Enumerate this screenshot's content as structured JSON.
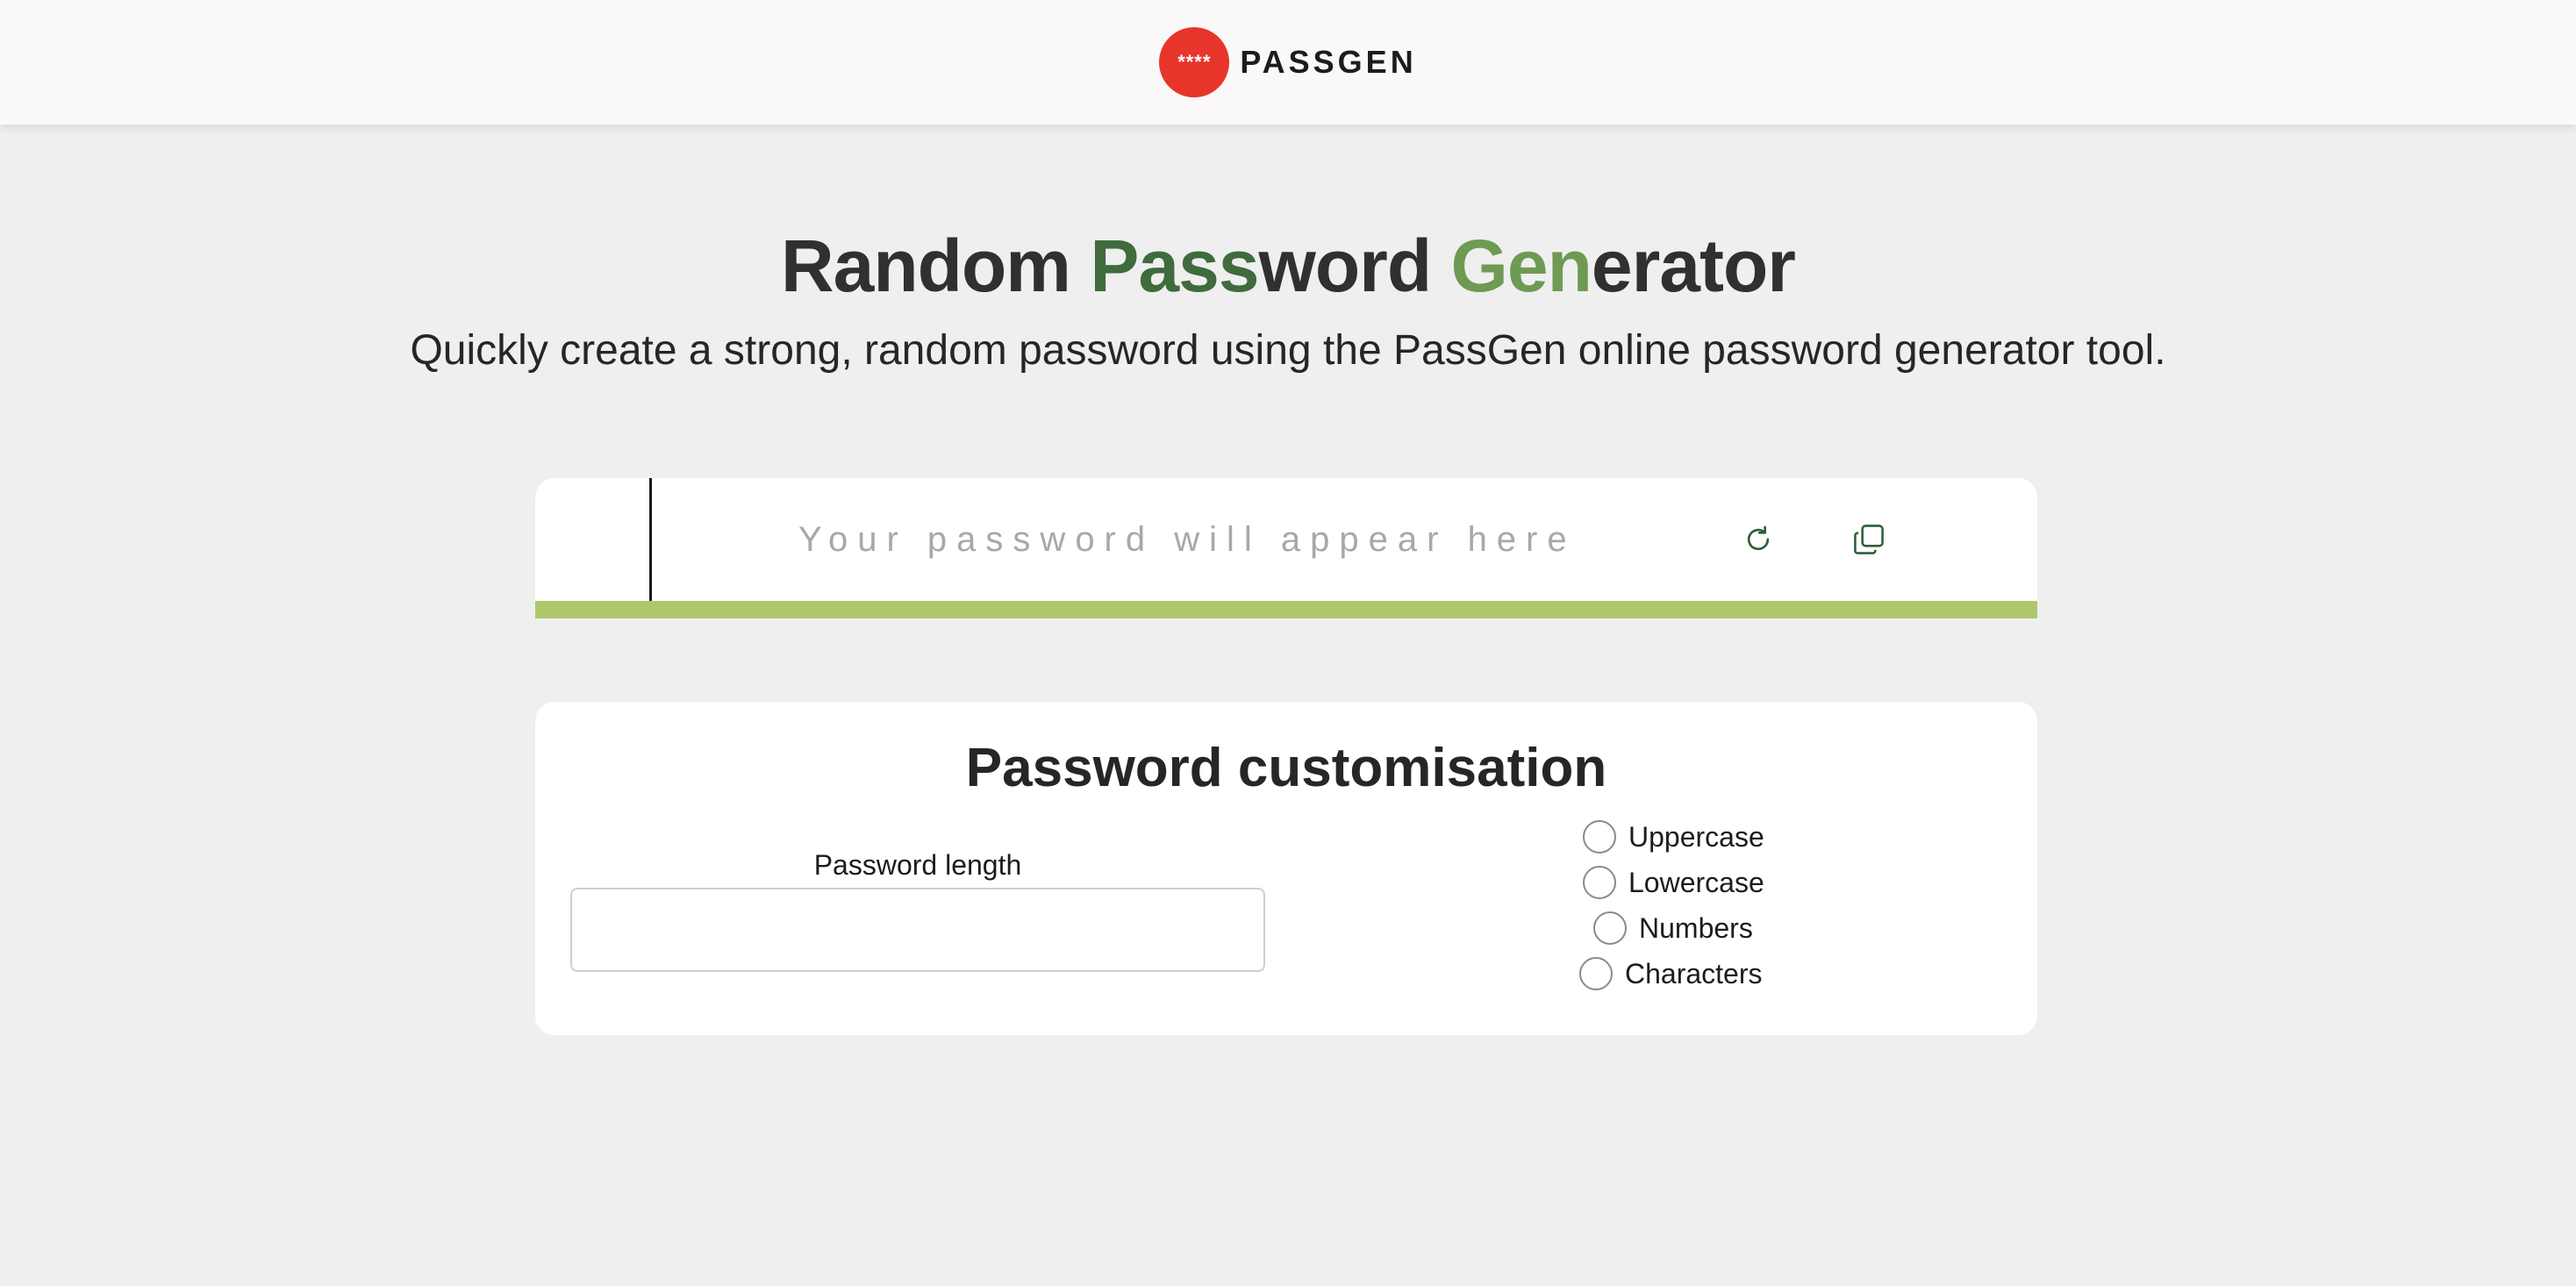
{
  "header": {
    "logo_badge": "****",
    "logo_text": "PASSGEN"
  },
  "hero": {
    "title_parts": [
      "Random ",
      "Pass",
      "word ",
      "Gen",
      "erator"
    ],
    "subtitle": "Quickly create a strong, random password using the PassGen online password generator tool."
  },
  "password": {
    "value": "",
    "placeholder": "Your password will appear here",
    "strength_fill": 1.0
  },
  "customisation": {
    "title": "Password customisation",
    "length_label": "Password length",
    "length_value": "",
    "options": [
      {
        "label": "Uppercase",
        "checked": false
      },
      {
        "label": "Lowercase",
        "checked": false
      },
      {
        "label": "Numbers",
        "checked": false
      },
      {
        "label": "Characters",
        "checked": false
      }
    ]
  },
  "icons": {
    "refresh": "refresh-icon",
    "copy": "copy-icon"
  },
  "colors": {
    "brand_red": "#e8352b",
    "dark_green": "#3f6b3d",
    "light_green": "#6f9a53",
    "strength_bar": "#adc76a",
    "icon_green": "#2f5e38"
  }
}
